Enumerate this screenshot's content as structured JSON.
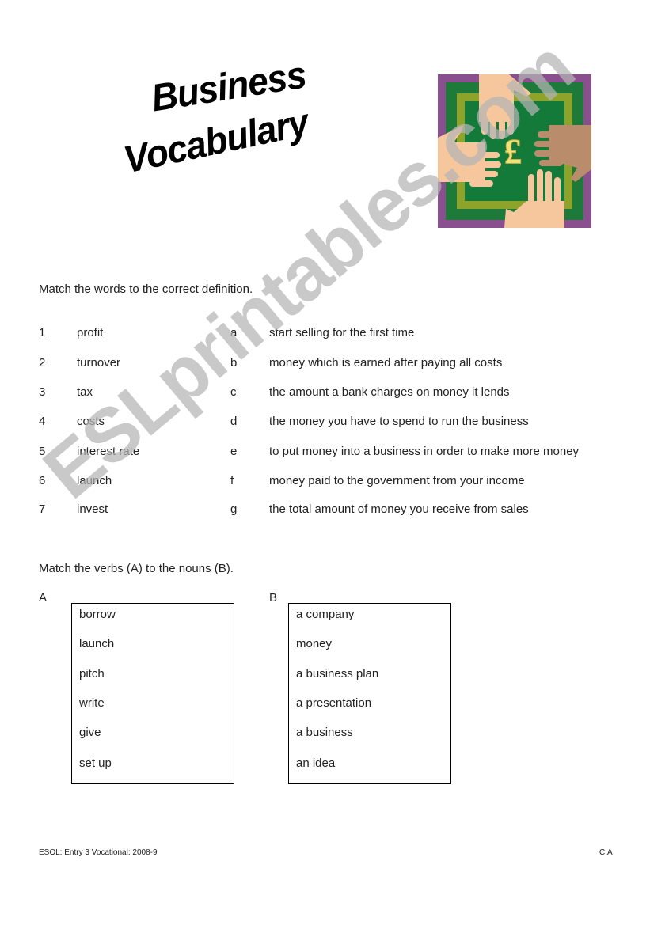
{
  "title": {
    "line1": "Business",
    "line2": "Vocabulary"
  },
  "logo": {
    "icon": "hands-pound-icon",
    "symbol": "£",
    "colors": {
      "border": "#8a4f8e",
      "outer_green": "#1e7a3a",
      "olive": "#8ea32a",
      "inner_green": "#137a3a",
      "skin_light": "#f6c79d",
      "skin_dark": "#b98d6b",
      "symbol": "#f2e27a"
    }
  },
  "exercise1": {
    "instruction": "Match the words to the correct definition.",
    "rows": [
      {
        "num": "1",
        "word": "profit",
        "letter": "a",
        "definition": "start selling for the first time"
      },
      {
        "num": "2",
        "word": "turnover",
        "letter": "b",
        "definition": "money which is earned after paying all costs"
      },
      {
        "num": "3",
        "word": "tax",
        "letter": "c",
        "definition": "the amount a bank charges on money it lends"
      },
      {
        "num": "4",
        "word": "costs",
        "letter": "d",
        "definition": "the money you have to spend to run the business"
      },
      {
        "num": "5",
        "word": "interest rate",
        "letter": "e",
        "definition": "to put money into a business in order to make more money"
      },
      {
        "num": "6",
        "word": "launch",
        "letter": "f",
        "definition": "money paid to the government from your income"
      },
      {
        "num": "7",
        "word": "invest",
        "letter": "g",
        "definition": "the total amount of money you receive from sales"
      }
    ]
  },
  "exercise2": {
    "instruction": "Match the verbs (A) to the nouns (B).",
    "column_a": {
      "label": "A",
      "items": [
        "borrow",
        "launch",
        "pitch",
        "write",
        "give",
        "set up"
      ]
    },
    "column_b": {
      "label": "B",
      "items": [
        "a company",
        "money",
        "a business plan",
        "a presentation",
        "a business",
        "an idea"
      ]
    }
  },
  "footer": {
    "left": "ESOL: Entry 3 Vocational: 2008-9",
    "right": "C.A"
  },
  "watermark": {
    "text": "ESLprintables.com",
    "color": "#c4c4c4"
  }
}
